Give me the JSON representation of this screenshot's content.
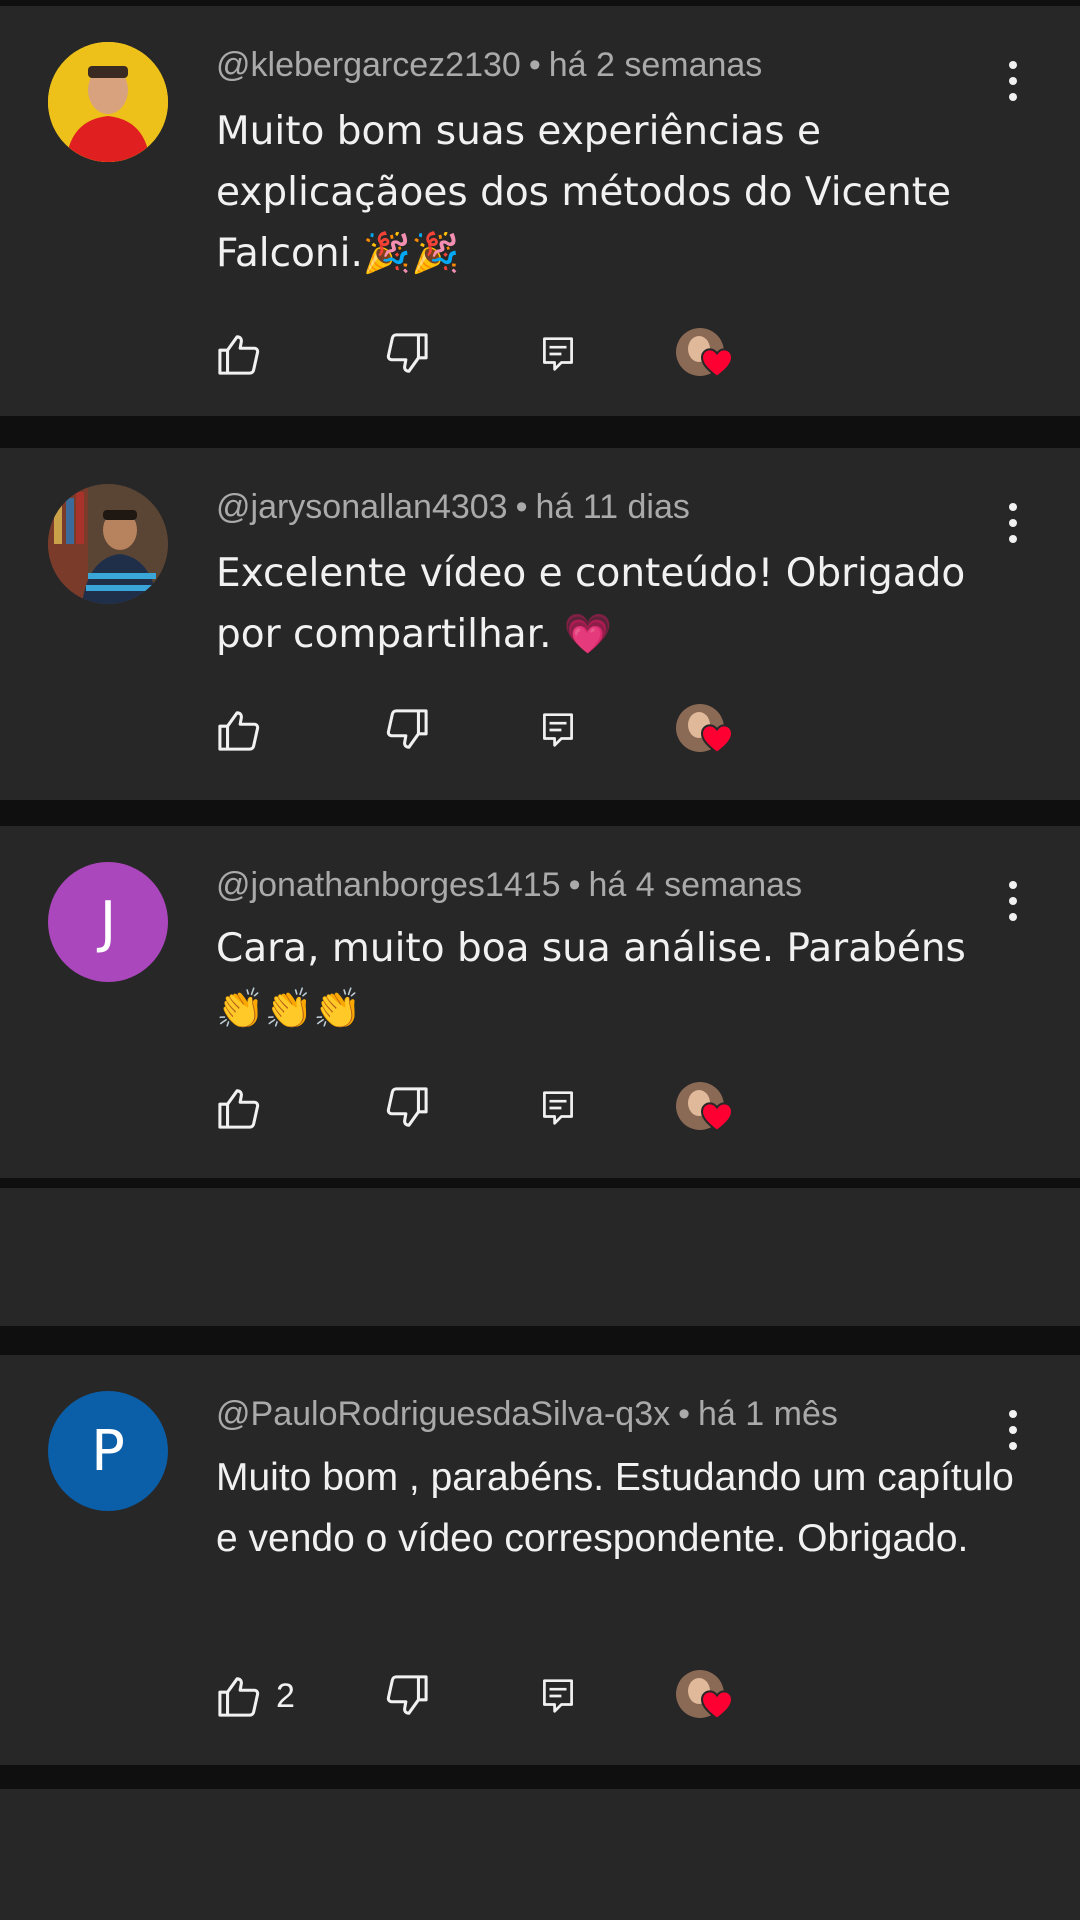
{
  "colors": {
    "background": "#0f0f0f",
    "card": "#272727",
    "meta_text": "#aaaaaa",
    "body_text": "#f1f1f1",
    "heart": "#ff0033",
    "avatar_j": "#ab47bc",
    "avatar_p": "#0b5ea8"
  },
  "separator": "•",
  "comments": [
    {
      "author": "@klebergarcez2130",
      "time": "há 2 semanas",
      "text": "Muito bom suas experiências e explicaçãoes dos métodos do Vicente Falconi.🎉🎉",
      "avatar_letter": "",
      "like_count": ""
    },
    {
      "author": "@jarysonallan4303",
      "time": "há 11 dias",
      "text": "Excelente vídeo e conteúdo! Obrigado por compartilhar. 💗",
      "avatar_letter": "",
      "like_count": ""
    },
    {
      "author": "@jonathanborges1415",
      "time": "há 4 semanas",
      "text": "Cara, muito boa sua análise. Parabéns 👏👏👏",
      "avatar_letter": "J",
      "like_count": ""
    },
    {
      "author": "@PauloRodriguesdaSilva-q3x",
      "time": "há 1 mês",
      "text": "Muito bom , parabéns. Estudando um capítulo e vendo o vídeo correspondente. Obrigado.",
      "avatar_letter": "P",
      "like_count": "2"
    }
  ],
  "icons": {
    "like": "thumb-up-icon",
    "dislike": "thumb-down-icon",
    "reply": "reply-comment-icon",
    "more": "more-vertical-icon",
    "creator_heart": "creator-heart-icon"
  }
}
